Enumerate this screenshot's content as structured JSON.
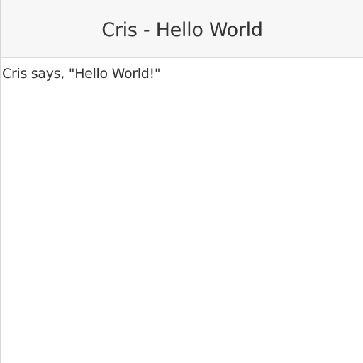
{
  "header": {
    "title": "Cris - Hello World"
  },
  "content": {
    "message": "Cris says, \"Hello World!\""
  }
}
